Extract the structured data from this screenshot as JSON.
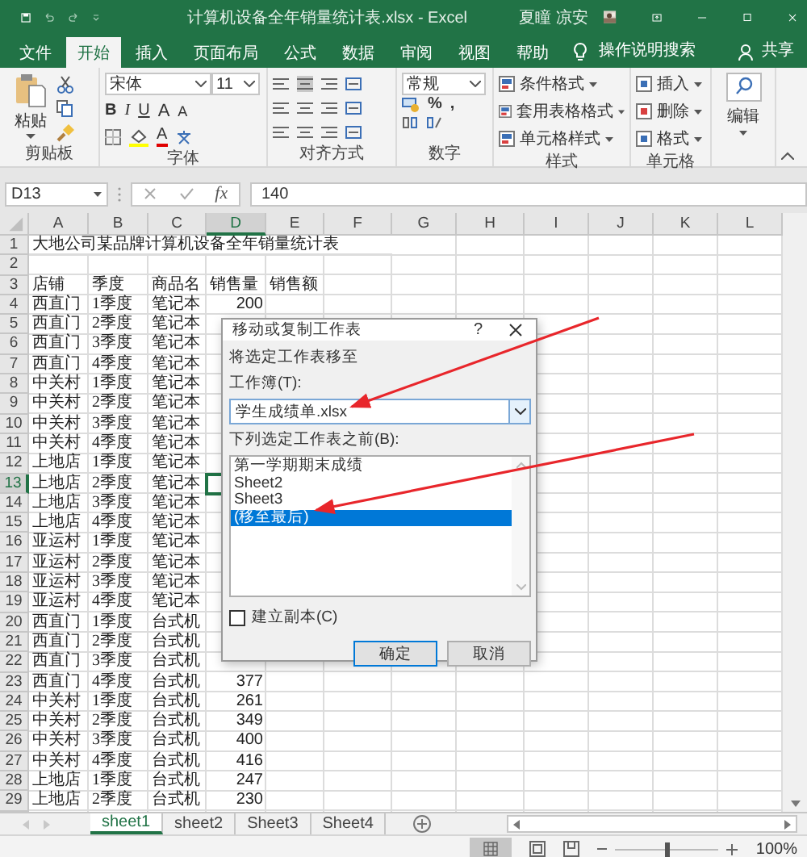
{
  "window": {
    "title": "计算机设备全年销量统计表.xlsx  -  Excel",
    "user": "夏瞳 凉安"
  },
  "tabs": [
    {
      "label": "文件",
      "selected": false
    },
    {
      "label": "开始",
      "selected": true
    },
    {
      "label": "插入",
      "selected": false
    },
    {
      "label": "页面布局",
      "selected": false
    },
    {
      "label": "公式",
      "selected": false
    },
    {
      "label": "数据",
      "selected": false
    },
    {
      "label": "审阅",
      "selected": false
    },
    {
      "label": "视图",
      "selected": false
    },
    {
      "label": "帮助",
      "selected": false
    }
  ],
  "tell_me": "操作说明搜索",
  "share": "共享",
  "ribbon": {
    "clipboard": {
      "paste": "粘贴",
      "label": "剪贴板"
    },
    "font": {
      "name": "宋体",
      "size": "11",
      "style_buttons": [
        "B",
        "I",
        "U"
      ],
      "size_buttons": [
        "A",
        "A"
      ],
      "color_button": "A",
      "label": "字体"
    },
    "alignment": {
      "label": "对齐方式"
    },
    "number": {
      "format": "常规",
      "symbols": [
        "%",
        ","
      ],
      "label": "数字"
    },
    "styles": {
      "items": [
        "条件格式",
        "套用表格格式",
        "单元格样式"
      ],
      "label": "样式"
    },
    "cells": {
      "items": [
        "插入",
        "删除",
        "格式"
      ],
      "label": "单元格"
    },
    "editing": {
      "label": "编辑"
    }
  },
  "formula_bar": {
    "name_box": "D13",
    "function_label": "fx",
    "value": "140"
  },
  "sheet": {
    "columns": [
      {
        "label": "A",
        "selected": false
      },
      {
        "label": "B",
        "selected": false
      },
      {
        "label": "C",
        "selected": false
      },
      {
        "label": "D",
        "selected": true
      },
      {
        "label": "E",
        "selected": false
      },
      {
        "label": "F",
        "selected": false
      },
      {
        "label": "G",
        "selected": false
      },
      {
        "label": "H",
        "selected": false
      },
      {
        "label": "I",
        "selected": false
      },
      {
        "label": "J",
        "selected": false
      },
      {
        "label": "K",
        "selected": false
      },
      {
        "label": "L",
        "selected": false
      }
    ],
    "rows": [
      {
        "number": "1",
        "kind": "title",
        "selected": false,
        "cells": [
          "大地公司某品牌计算机设备全年销量统计表"
        ]
      },
      {
        "number": "2",
        "kind": "data",
        "selected": false,
        "cells": []
      },
      {
        "number": "3",
        "kind": "data",
        "selected": false,
        "cells": [
          "店铺",
          "季度",
          "商品名",
          "销售量",
          "销售额"
        ]
      },
      {
        "number": "4",
        "kind": "data",
        "selected": false,
        "cells": [
          "西直门",
          "1季度",
          "笔记本",
          "200"
        ]
      },
      {
        "number": "5",
        "kind": "data",
        "selected": false,
        "cells": [
          "西直门",
          "2季度",
          "笔记本"
        ]
      },
      {
        "number": "6",
        "kind": "data",
        "selected": false,
        "cells": [
          "西直门",
          "3季度",
          "笔记本"
        ]
      },
      {
        "number": "7",
        "kind": "data",
        "selected": false,
        "cells": [
          "西直门",
          "4季度",
          "笔记本"
        ]
      },
      {
        "number": "8",
        "kind": "data",
        "selected": false,
        "cells": [
          "中关村",
          "1季度",
          "笔记本"
        ]
      },
      {
        "number": "9",
        "kind": "data",
        "selected": false,
        "cells": [
          "中关村",
          "2季度",
          "笔记本"
        ]
      },
      {
        "number": "10",
        "kind": "data",
        "selected": false,
        "cells": [
          "中关村",
          "3季度",
          "笔记本"
        ]
      },
      {
        "number": "11",
        "kind": "data",
        "selected": false,
        "cells": [
          "中关村",
          "4季度",
          "笔记本"
        ]
      },
      {
        "number": "12",
        "kind": "data",
        "selected": false,
        "cells": [
          "上地店",
          "1季度",
          "笔记本"
        ]
      },
      {
        "number": "13",
        "kind": "data",
        "selected": true,
        "cells": [
          "上地店",
          "2季度",
          "笔记本"
        ]
      },
      {
        "number": "14",
        "kind": "data",
        "selected": false,
        "cells": [
          "上地店",
          "3季度",
          "笔记本"
        ]
      },
      {
        "number": "15",
        "kind": "data",
        "selected": false,
        "cells": [
          "上地店",
          "4季度",
          "笔记本"
        ]
      },
      {
        "number": "16",
        "kind": "data",
        "selected": false,
        "cells": [
          "亚运村",
          "1季度",
          "笔记本"
        ]
      },
      {
        "number": "17",
        "kind": "data",
        "selected": false,
        "cells": [
          "亚运村",
          "2季度",
          "笔记本"
        ]
      },
      {
        "number": "18",
        "kind": "data",
        "selected": false,
        "cells": [
          "亚运村",
          "3季度",
          "笔记本"
        ]
      },
      {
        "number": "19",
        "kind": "data",
        "selected": false,
        "cells": [
          "亚运村",
          "4季度",
          "笔记本"
        ]
      },
      {
        "number": "20",
        "kind": "data",
        "selected": false,
        "cells": [
          "西直门",
          "1季度",
          "台式机"
        ]
      },
      {
        "number": "21",
        "kind": "data",
        "selected": false,
        "cells": [
          "西直门",
          "2季度",
          "台式机"
        ]
      },
      {
        "number": "22",
        "kind": "data",
        "selected": false,
        "cells": [
          "西直门",
          "3季度",
          "台式机"
        ]
      },
      {
        "number": "23",
        "kind": "data",
        "selected": false,
        "cells": [
          "西直门",
          "4季度",
          "台式机",
          "377"
        ]
      },
      {
        "number": "24",
        "kind": "data",
        "selected": false,
        "cells": [
          "中关村",
          "1季度",
          "台式机",
          "261"
        ]
      },
      {
        "number": "25",
        "kind": "data",
        "selected": false,
        "cells": [
          "中关村",
          "2季度",
          "台式机",
          "349"
        ]
      },
      {
        "number": "26",
        "kind": "data",
        "selected": false,
        "cells": [
          "中关村",
          "3季度",
          "台式机",
          "400"
        ]
      },
      {
        "number": "27",
        "kind": "data",
        "selected": false,
        "cells": [
          "中关村",
          "4季度",
          "台式机",
          "416"
        ]
      },
      {
        "number": "28",
        "kind": "data",
        "selected": false,
        "cells": [
          "上地店",
          "1季度",
          "台式机",
          "247"
        ]
      },
      {
        "number": "29",
        "kind": "data",
        "selected": false,
        "cells": [
          "上地店",
          "2季度",
          "台式机",
          "230"
        ]
      }
    ]
  },
  "dialog": {
    "title": "移动或复制工作表",
    "help": "?",
    "section_label": "将选定工作表移至",
    "workbook_label": "工作簿(T):",
    "workbook_value": "学生成绩单.xlsx",
    "before_label": "下列选定工作表之前(B):",
    "sheets": [
      {
        "label": "第一学期期末成绩",
        "selected": false
      },
      {
        "label": "Sheet2",
        "selected": false
      },
      {
        "label": "Sheet3",
        "selected": false
      },
      {
        "label": "(移至最后)",
        "selected": true
      }
    ],
    "copy_option": {
      "label": "建立副本(C)",
      "checked": false
    },
    "buttons": [
      "确定",
      "取消"
    ]
  },
  "sheet_tabs": [
    {
      "label": "sheet1",
      "selected": true
    },
    {
      "label": "sheet2",
      "selected": false
    },
    {
      "label": "Sheet3",
      "selected": false
    },
    {
      "label": "Sheet4",
      "selected": false
    }
  ],
  "status_bar": {
    "zoom_level": {
      "level": 0.5
    },
    "zoom": "100%"
  }
}
